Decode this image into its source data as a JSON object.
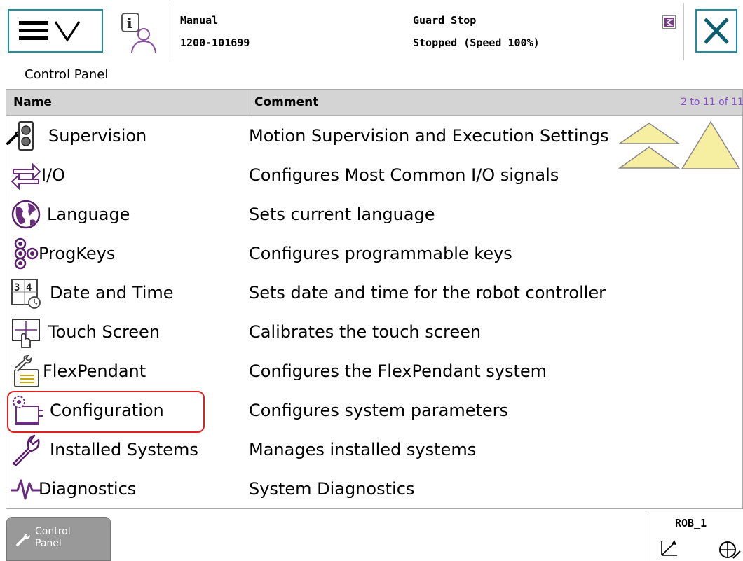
{
  "header": {
    "mode": "Manual",
    "system_id": "1200-101699",
    "state": "Guard Stop",
    "speed": "Stopped (Speed 100%)"
  },
  "breadcrumb": "Control Panel",
  "table": {
    "col_name": "Name",
    "col_comment": "Comment",
    "paging": "2 to 11 of 11",
    "rows": [
      {
        "name": "Supervision",
        "comment": "Motion Supervision and Execution Settings",
        "icon": "supervision-icon"
      },
      {
        "name": "I/O",
        "comment": "Configures Most Common I/O signals",
        "icon": "io-icon"
      },
      {
        "name": "Language",
        "comment": "Sets current language",
        "icon": "language-icon"
      },
      {
        "name": "ProgKeys",
        "comment": "Configures programmable keys",
        "icon": "progkeys-icon"
      },
      {
        "name": "Date and Time",
        "comment": "Sets date and time for the robot controller",
        "icon": "date-time-icon"
      },
      {
        "name": "Touch Screen",
        "comment": "Calibrates the touch screen",
        "icon": "touch-screen-icon"
      },
      {
        "name": "FlexPendant",
        "comment": "Configures the FlexPendant system",
        "icon": "flexpendant-icon"
      },
      {
        "name": "Configuration",
        "comment": "Configures system parameters",
        "icon": "configuration-icon"
      },
      {
        "name": "Installed Systems",
        "comment": "Manages installed systems",
        "icon": "wrench-icon"
      },
      {
        "name": "Diagnostics",
        "comment": "System Diagnostics",
        "icon": "diagnostics-icon"
      }
    ]
  },
  "taskbar": {
    "control_panel_line1": "Control",
    "control_panel_line2": "Panel",
    "robot": "ROB_1"
  },
  "colors": {
    "accent": "#1a8fa5",
    "highlight": "#e02020",
    "paging": "#8a4fd0",
    "scroll_arrow": "#f6eea0"
  }
}
